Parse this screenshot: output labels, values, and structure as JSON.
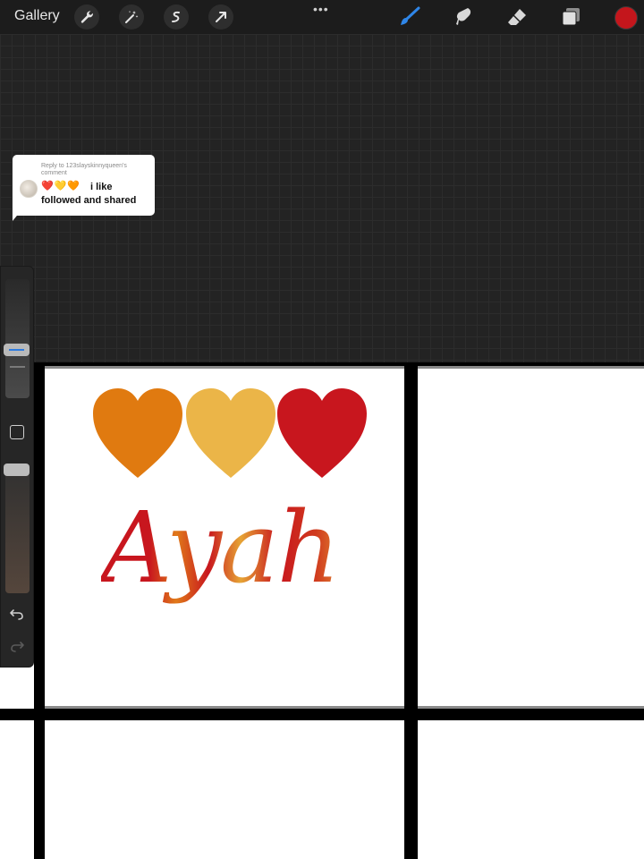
{
  "toolbar": {
    "gallery_label": "Gallery",
    "left_tools": [
      "wrench-icon",
      "magic-wand-icon",
      "selection-icon",
      "transform-arrow-icon"
    ],
    "more_label": "•••",
    "right_tools": [
      "brush-icon",
      "smudge-icon",
      "eraser-icon",
      "layers-icon"
    ],
    "active_tool": "brush-icon",
    "current_color": "#c4161c"
  },
  "comment": {
    "reply_to": "Reply to 123slayskinnyqueen's comment",
    "hearts": [
      "❤️",
      "💛",
      "🧡"
    ],
    "text_line1": "i like",
    "text_line2": "followed and shared"
  },
  "artwork": {
    "heart_colors": [
      "#e07a10",
      "#ebb548",
      "#c8161e"
    ],
    "word": "Ayah"
  },
  "side_panel": {
    "brush_size_level": 0.35,
    "opacity_level": 1.0
  }
}
